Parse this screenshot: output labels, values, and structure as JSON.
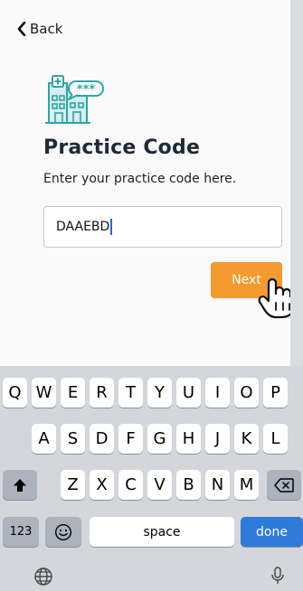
{
  "nav": {
    "back_label": "Back"
  },
  "page": {
    "title": "Practice Code",
    "subtitle": "Enter your practice code here.",
    "icon": "hospital-building-icon",
    "badge_text": "***"
  },
  "form": {
    "code_value": "DAAEBD",
    "next_label": "Next"
  },
  "colors": {
    "accent_orange": "#f59a2f",
    "icon_teal": "#2ca6a4",
    "keyboard_done": "#2f7bd9"
  },
  "keyboard": {
    "row1": [
      "Q",
      "W",
      "E",
      "R",
      "T",
      "Y",
      "U",
      "I",
      "O",
      "P"
    ],
    "row2": [
      "A",
      "S",
      "D",
      "F",
      "G",
      "H",
      "J",
      "K",
      "L"
    ],
    "row3": [
      "Z",
      "X",
      "C",
      "V",
      "B",
      "N",
      "M"
    ],
    "numbers_label": "123",
    "space_label": "space",
    "done_label": "done"
  }
}
